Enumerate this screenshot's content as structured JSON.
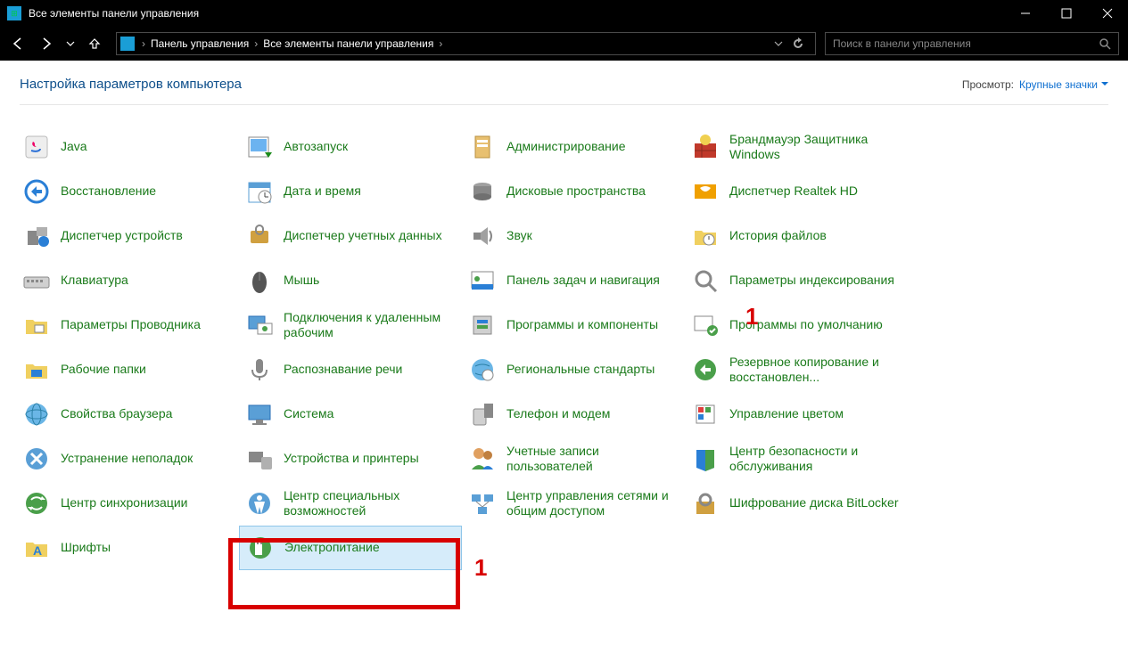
{
  "window": {
    "title": "Все элементы панели управления"
  },
  "breadcrumb": {
    "root": "Панель управления",
    "current": "Все элементы панели управления"
  },
  "search": {
    "placeholder": "Поиск в панели управления"
  },
  "header": {
    "title": "Настройка параметров компьютера",
    "view_label": "Просмотр:",
    "view_value": "Крупные значки"
  },
  "items": [
    {
      "label": "Java",
      "icon": "#ic-java"
    },
    {
      "label": "Автозапуск",
      "icon": "#ic-autoplay"
    },
    {
      "label": "Администрирование",
      "icon": "#ic-admin"
    },
    {
      "label": "Брандмауэр Защитника Windows",
      "icon": "#ic-firewall"
    },
    {
      "label": "Восстановление",
      "icon": "#ic-recovery"
    },
    {
      "label": "Дата и время",
      "icon": "#ic-datetime"
    },
    {
      "label": "Дисковые пространства",
      "icon": "#ic-storage"
    },
    {
      "label": "Диспетчер Realtek HD",
      "icon": "#ic-realtek"
    },
    {
      "label": "Диспетчер устройств",
      "icon": "#ic-devmgr"
    },
    {
      "label": "Диспетчер учетных данных",
      "icon": "#ic-credmgr"
    },
    {
      "label": "Звук",
      "icon": "#ic-sound"
    },
    {
      "label": "История файлов",
      "icon": "#ic-filehistory"
    },
    {
      "label": "Клавиатура",
      "icon": "#ic-keyboard"
    },
    {
      "label": "Мышь",
      "icon": "#ic-mouse"
    },
    {
      "label": "Панель задач и навигация",
      "icon": "#ic-taskbar"
    },
    {
      "label": "Параметры индексирования",
      "icon": "#ic-indexing"
    },
    {
      "label": "Параметры Проводника",
      "icon": "#ic-explorer"
    },
    {
      "label": "Подключения к удаленным рабочим",
      "icon": "#ic-remote"
    },
    {
      "label": "Программы и компоненты",
      "icon": "#ic-programs"
    },
    {
      "label": "Программы по умолчанию",
      "icon": "#ic-default"
    },
    {
      "label": "Рабочие папки",
      "icon": "#ic-workfolders"
    },
    {
      "label": "Распознавание речи",
      "icon": "#ic-speech"
    },
    {
      "label": "Региональные стандарты",
      "icon": "#ic-region"
    },
    {
      "label": "Резервное копирование и восстановлен...",
      "icon": "#ic-backup"
    },
    {
      "label": "Свойства браузера",
      "icon": "#ic-internet"
    },
    {
      "label": "Система",
      "icon": "#ic-system"
    },
    {
      "label": "Телефон и модем",
      "icon": "#ic-phone"
    },
    {
      "label": "Управление цветом",
      "icon": "#ic-color"
    },
    {
      "label": "Устранение неполадок",
      "icon": "#ic-troubleshoot"
    },
    {
      "label": "Устройства и принтеры",
      "icon": "#ic-devices"
    },
    {
      "label": "Учетные записи пользователей",
      "icon": "#ic-users"
    },
    {
      "label": "Центр безопасности и обслуживания",
      "icon": "#ic-security"
    },
    {
      "label": "Центр синхронизации",
      "icon": "#ic-sync"
    },
    {
      "label": "Центр специальных возможностей",
      "icon": "#ic-ease"
    },
    {
      "label": "Центр управления сетями и общим доступом",
      "icon": "#ic-network"
    },
    {
      "label": "Шифрование диска BitLocker",
      "icon": "#ic-bitlocker"
    },
    {
      "label": "Шрифты",
      "icon": "#ic-fonts"
    },
    {
      "label": "Электропитание",
      "icon": "#ic-power",
      "selected": true
    }
  ],
  "annotations": {
    "highlight_marker": "1",
    "secondary_marker": "1"
  }
}
